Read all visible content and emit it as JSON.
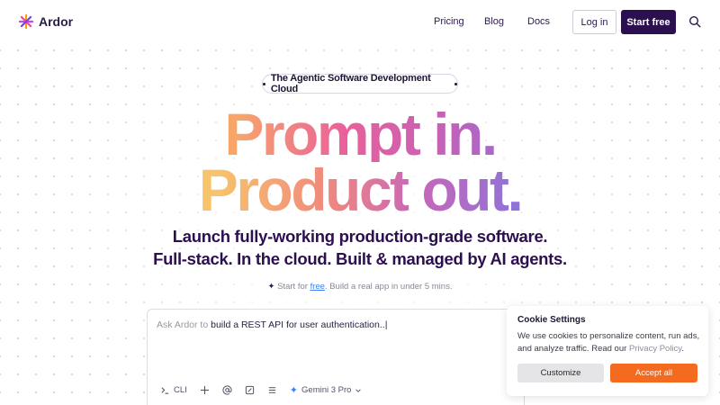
{
  "header": {
    "brand": "Ardor",
    "nav": [
      "Pricing",
      "Blog",
      "Docs"
    ],
    "login_label": "Log in",
    "start_label": "Start free"
  },
  "hero": {
    "pill_text": "The Agentic Software Development Cloud",
    "headline_line1": "Prompt in.",
    "headline_line2": "Product out.",
    "sub_line1": "Launch fully-working production-grade software.",
    "sub_line2": "Full-stack. In the cloud. Built & managed by AI agents.",
    "note_before": "Start for ",
    "note_link": "free",
    "note_after": ". Build a real app in under 5 mins."
  },
  "prompt": {
    "prefix": "Ask Ardor to ",
    "value": "build a REST API for user authentication..|",
    "cli_label": "CLI",
    "model_label": "Gemini 3 Pro"
  },
  "cookie": {
    "title": "Cookie Settings",
    "body": "We use cookies to personalize content, run ads, and analyze traffic. Read our ",
    "policy_link": "Privacy Policy",
    "body_end": ".",
    "customize_label": "Customize",
    "accept_label": "Accept all"
  },
  "colors": {
    "brand_dark": "#2c0f4f",
    "accent_orange": "#f46a1f",
    "link_blue": "#3b82f6"
  },
  "icons": {
    "logo": "ardor-asterisk-icon",
    "search": "search-icon",
    "note": "sparkle-icon",
    "model": "gemini-icon"
  }
}
